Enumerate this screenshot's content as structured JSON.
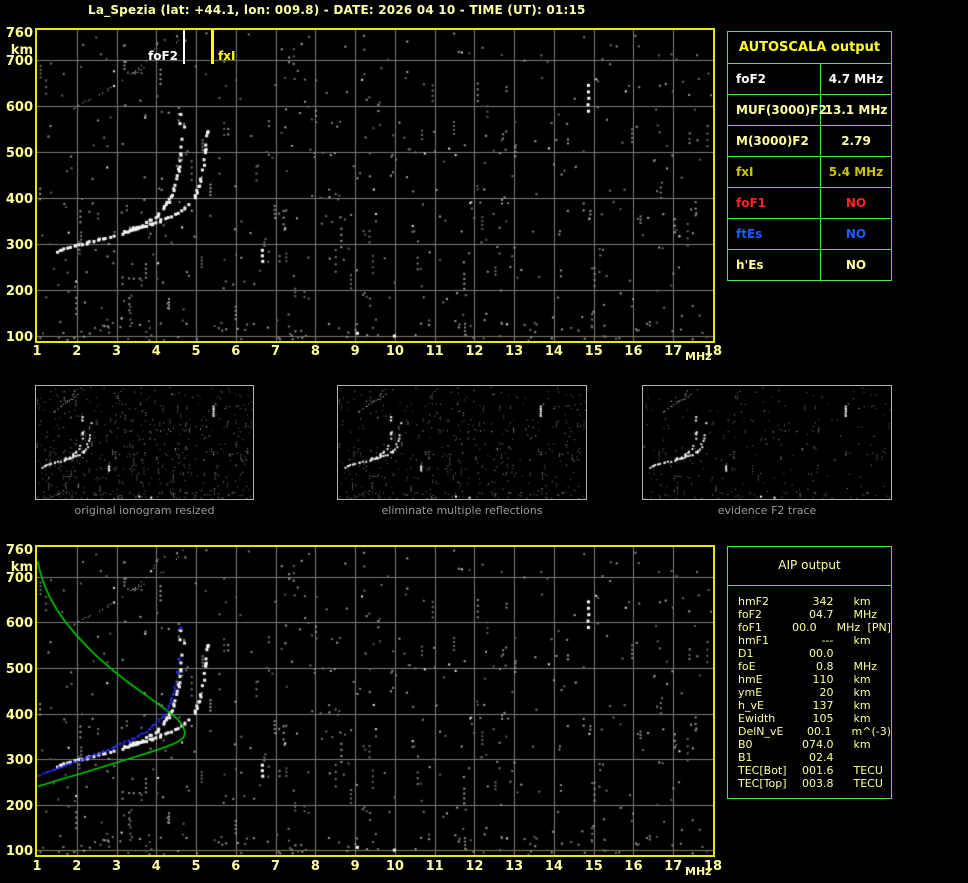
{
  "title": "La_Spezia (lat: +44.1, lon: 009.8) - DATE: 2026 04 10 - TIME (UT): 01:15",
  "colors": {
    "frame": "#e8e800",
    "grid": "#7a7a7a",
    "axis_text": "#ffff9c",
    "title_text": "#ffffa8",
    "profile_green": "#00cc00",
    "trace_blue": "#2a2cff",
    "trace_white": "#f4f4f4",
    "multiple_gray": "#d8d8d8",
    "caption_gray": "#9a9a9a",
    "table_border": "#4ce44c",
    "autoscala_header": "#ffff2e",
    "aip_text": "#ffff9c",
    "fof2_marker": "#ffffff",
    "fxi_marker": "#ffff00"
  },
  "axes": {
    "x_ticks": [
      "1",
      "2",
      "3",
      "4",
      "5",
      "6",
      "7",
      "8",
      "9",
      "10",
      "11",
      "12",
      "13",
      "14",
      "15",
      "16",
      "17",
      "18"
    ],
    "x_unit": "MHz",
    "y_ticks": [
      "760",
      "700",
      "600",
      "500",
      "400",
      "300",
      "200",
      "100"
    ],
    "y_tick_km": [
      760,
      700,
      600,
      500,
      400,
      300,
      200,
      100
    ],
    "y_unit": "km"
  },
  "top_plot": {
    "fof2_label": "foF2",
    "fof2_mhz": 4.7,
    "fxi_label": "fxI",
    "fxi_mhz": 5.4
  },
  "autoscala_table": {
    "header": "AUTOSCALA output",
    "rows": [
      {
        "label": "foF2",
        "value": "4.7 MHz",
        "color": "#ffffff"
      },
      {
        "label": "MUF(3000)F2",
        "value": "13.1 MHz",
        "color": "#ffff9c"
      },
      {
        "label": "M(3000)F2",
        "value": "2.79",
        "color": "#ffff9c"
      },
      {
        "label": "fxI",
        "value": "5.4 MHz",
        "color": "#cdc400"
      },
      {
        "label": "foF1",
        "value": "NO",
        "color": "#ff2222"
      },
      {
        "label": "ftEs",
        "value": "NO",
        "color": "#1a5cff"
      },
      {
        "label": "h'Es",
        "value": "NO",
        "color": "#ffff9c"
      }
    ]
  },
  "thumbnails": [
    {
      "caption": "original ionogram resized"
    },
    {
      "caption": "eliminate multiple reflections"
    },
    {
      "caption": "evidence F2 trace"
    }
  ],
  "aip_table": {
    "header": "AIP output",
    "rows": [
      {
        "label": "hmF2",
        "value": "342",
        "unit": "km",
        "extra": ""
      },
      {
        "label": "foF2",
        "value": "04.7",
        "unit": "MHz",
        "extra": ""
      },
      {
        "label": "foF1",
        "value": "00.0",
        "unit": "MHz",
        "extra": "[PN]"
      },
      {
        "label": "hmF1",
        "value": "---",
        "unit": "km",
        "extra": ""
      },
      {
        "label": "D1",
        "value": "00.0",
        "unit": "",
        "extra": ""
      },
      {
        "label": "foE",
        "value": "0.8",
        "unit": "MHz",
        "extra": ""
      },
      {
        "label": "hmE",
        "value": "110",
        "unit": "km",
        "extra": ""
      },
      {
        "label": "ymE",
        "value": "20",
        "unit": "km",
        "extra": ""
      },
      {
        "label": "h_vE",
        "value": "137",
        "unit": "km",
        "extra": ""
      },
      {
        "label": "Ewidth",
        "value": "105",
        "unit": "km",
        "extra": ""
      },
      {
        "label": "DelN_vE",
        "value": "00.1",
        "unit": "m^(-3)",
        "extra": ""
      },
      {
        "label": "B0",
        "value": "074.0",
        "unit": "km",
        "extra": ""
      },
      {
        "label": "B1",
        "value": "02.4",
        "unit": "",
        "extra": ""
      },
      {
        "label": "TEC[Bot]",
        "value": "001.6",
        "unit": "TECU",
        "extra": ""
      },
      {
        "label": "TEC[Top]",
        "value": "003.8",
        "unit": "TECU",
        "extra": ""
      }
    ]
  },
  "chart_data": {
    "type": "scatter",
    "title": "Ionogram with autoscaled F2 traces",
    "xlabel": "MHz",
    "ylabel": "km",
    "xlim": [
      1,
      18
    ],
    "ylim": [
      100,
      760
    ],
    "grid": true,
    "o_trace": [
      [
        1.5,
        288
      ],
      [
        1.7,
        293
      ],
      [
        1.9,
        298
      ],
      [
        2.1,
        303
      ],
      [
        2.35,
        308
      ],
      [
        2.6,
        314
      ],
      [
        2.85,
        320
      ],
      [
        3.1,
        327
      ],
      [
        3.35,
        335
      ],
      [
        3.6,
        344
      ],
      [
        3.8,
        354
      ],
      [
        4.0,
        366
      ],
      [
        4.15,
        380
      ],
      [
        4.28,
        396
      ],
      [
        4.38,
        415
      ],
      [
        4.46,
        437
      ],
      [
        4.52,
        462
      ],
      [
        4.57,
        490
      ],
      [
        4.61,
        520
      ],
      [
        4.64,
        548
      ],
      [
        4.66,
        570
      ]
    ],
    "x_trace": [
      [
        3.3,
        333
      ],
      [
        3.55,
        339
      ],
      [
        3.8,
        346
      ],
      [
        4.05,
        353
      ],
      [
        4.3,
        361
      ],
      [
        4.55,
        372
      ],
      [
        4.75,
        385
      ],
      [
        4.9,
        400
      ],
      [
        5.0,
        418
      ],
      [
        5.08,
        440
      ],
      [
        5.14,
        465
      ],
      [
        5.18,
        492
      ],
      [
        5.21,
        520
      ],
      [
        5.24,
        548
      ],
      [
        5.26,
        568
      ]
    ],
    "profile_green": [
      [
        1.02,
        733
      ],
      [
        1.08,
        710
      ],
      [
        1.18,
        683
      ],
      [
        1.32,
        655
      ],
      [
        1.5,
        628
      ],
      [
        1.72,
        600
      ],
      [
        1.98,
        573
      ],
      [
        2.28,
        545
      ],
      [
        2.6,
        518
      ],
      [
        2.95,
        492
      ],
      [
        3.3,
        468
      ],
      [
        3.65,
        446
      ],
      [
        4.0,
        424
      ],
      [
        4.3,
        405
      ],
      [
        4.52,
        389
      ],
      [
        4.66,
        374
      ],
      [
        4.72,
        360
      ],
      [
        4.7,
        350
      ],
      [
        4.6,
        341
      ],
      [
        4.42,
        333
      ],
      [
        4.15,
        324
      ],
      [
        3.8,
        314
      ],
      [
        3.4,
        303
      ],
      [
        2.95,
        291
      ],
      [
        2.5,
        279
      ],
      [
        2.05,
        267
      ],
      [
        1.65,
        257
      ],
      [
        1.35,
        249
      ],
      [
        1.12,
        243
      ],
      [
        1.02,
        240
      ]
    ],
    "restored_blue": [
      [
        1.02,
        266
      ],
      [
        1.25,
        274
      ],
      [
        1.5,
        282
      ],
      [
        1.75,
        290
      ],
      [
        2.0,
        298
      ],
      [
        2.25,
        306
      ],
      [
        2.5,
        314
      ],
      [
        2.75,
        322
      ],
      [
        3.0,
        331
      ],
      [
        3.25,
        341
      ],
      [
        3.5,
        351
      ],
      [
        3.7,
        361
      ],
      [
        3.88,
        372
      ],
      [
        4.03,
        384
      ],
      [
        4.16,
        398
      ],
      [
        4.27,
        414
      ],
      [
        4.36,
        432
      ],
      [
        4.43,
        452
      ],
      [
        4.48,
        470
      ]
    ],
    "restored_blue_extra": [
      [
        4.52,
        492
      ],
      [
        4.56,
        520
      ],
      [
        4.6,
        588
      ]
    ],
    "bright_spots": [
      [
        14.83,
        648
      ],
      [
        14.83,
        634
      ],
      [
        14.84,
        620
      ],
      [
        14.82,
        606
      ],
      [
        14.83,
        592
      ],
      [
        6.63,
        290
      ],
      [
        6.63,
        278
      ],
      [
        6.64,
        266
      ],
      [
        9.02,
        110
      ],
      [
        9.95,
        104
      ],
      [
        4.56,
        565
      ],
      [
        4.58,
        585
      ]
    ],
    "noise": {
      "seed": 1337,
      "uniform": 430,
      "runs": 75,
      "bottom_band": 80,
      "bright": 26
    }
  }
}
